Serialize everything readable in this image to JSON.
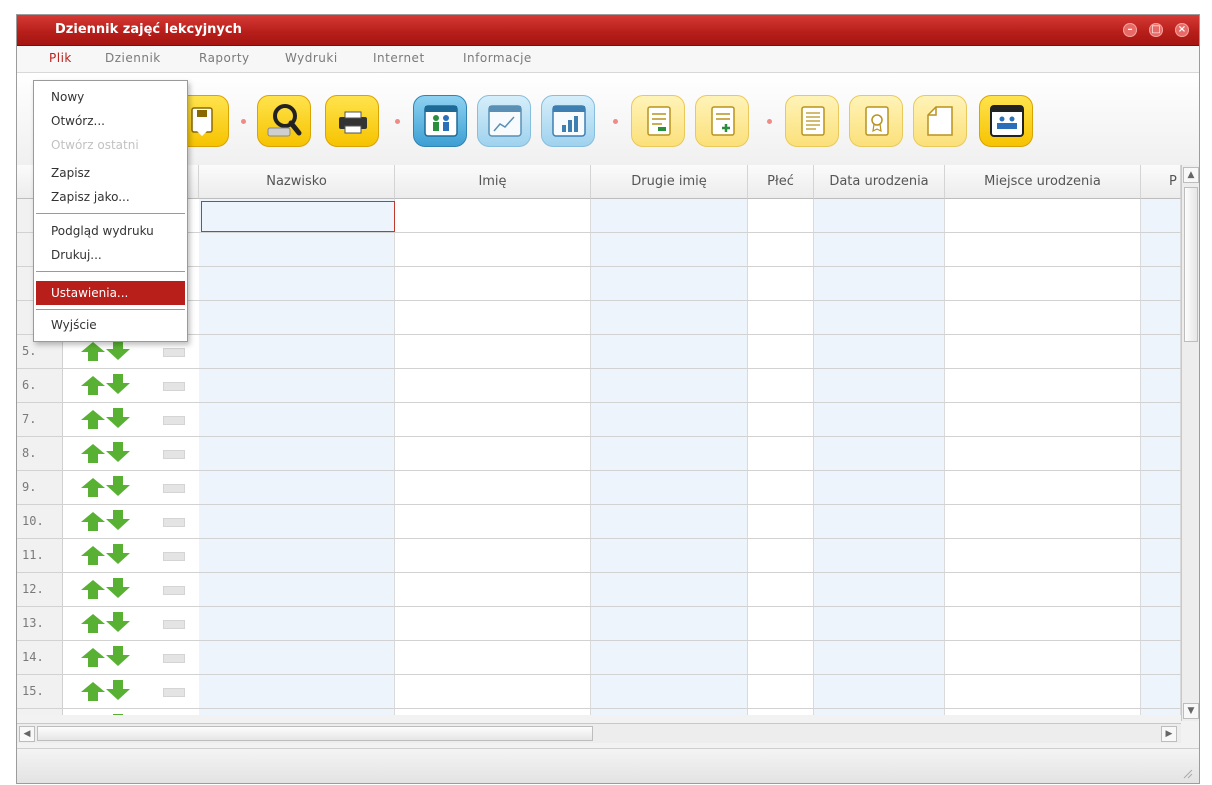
{
  "window": {
    "title": "Dziennik zajęć lekcyjnych",
    "controls": {
      "minimize": "–",
      "maximize": "□",
      "close": "×"
    }
  },
  "menubar": {
    "items": [
      "Plik",
      "Dziennik",
      "Raporty",
      "Wydruki",
      "Internet",
      "Informacje"
    ],
    "active": "Plik"
  },
  "file_menu": {
    "items": [
      {
        "label": "Nowy",
        "enabled": true
      },
      {
        "label": "Otwórz...",
        "enabled": true
      },
      {
        "label": "Otwórz ostatni",
        "enabled": false
      },
      {
        "label": "Zapisz",
        "enabled": true
      },
      {
        "label": "Zapisz jako...",
        "enabled": true
      },
      {
        "label": "Podgląd wydruku",
        "enabled": true
      },
      {
        "label": "Drukuj...",
        "enabled": true
      },
      {
        "label": "Ustawienia...",
        "enabled": true,
        "highlighted": true
      },
      {
        "label": "Wyjście",
        "enabled": true
      }
    ]
  },
  "toolbar": {
    "buttons": [
      {
        "icon": "save-icon",
        "style": "yellow"
      },
      {
        "icon": "search-icon",
        "style": "yellow"
      },
      {
        "icon": "print-icon",
        "style": "yellow"
      },
      {
        "icon": "students-window-icon",
        "style": "blue"
      },
      {
        "icon": "line-chart-window-icon",
        "style": "light-blue"
      },
      {
        "icon": "bar-chart-window-icon",
        "style": "light-blue"
      },
      {
        "icon": "document-list-icon",
        "style": "light-yellow"
      },
      {
        "icon": "document-add-icon",
        "style": "light-yellow"
      },
      {
        "icon": "notes-icon",
        "style": "light-yellow"
      },
      {
        "icon": "certificate-icon",
        "style": "light-yellow"
      },
      {
        "icon": "blank-page-icon",
        "style": "light-yellow"
      },
      {
        "icon": "classroom-window-icon",
        "style": "yellow"
      }
    ]
  },
  "table": {
    "columns": [
      "Nazwisko",
      "Imię",
      "Drugie imię",
      "Płeć",
      "Data urodzenia",
      "Miejsce urodzenia",
      "P"
    ],
    "visible_row_numbers": [
      "5.",
      "6.",
      "7.",
      "8.",
      "9.",
      "10.",
      "11.",
      "12.",
      "13.",
      "14.",
      "15."
    ]
  },
  "colors": {
    "title_bar": "#b81f1b",
    "menu_highlight": "#b81f1b",
    "arrow_green": "#58b133",
    "toolbar_yellow": "#f6c300",
    "toolbar_blue": "#3d9fd3",
    "column_tint": "#eef4fb"
  }
}
